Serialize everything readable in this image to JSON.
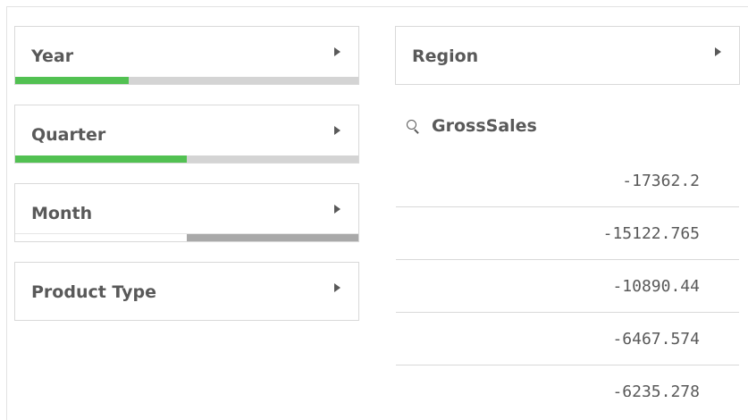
{
  "filters": {
    "year": {
      "label": "Year",
      "bar": [
        {
          "fraction": 0.33,
          "color": "#52c152"
        },
        {
          "fraction": 0.67,
          "color": "#d4d4d4"
        }
      ]
    },
    "quarter": {
      "label": "Quarter",
      "bar": [
        {
          "fraction": 0.5,
          "color": "#52c152"
        },
        {
          "fraction": 0.5,
          "color": "#d4d4d4"
        }
      ]
    },
    "month": {
      "label": "Month",
      "bar": [
        {
          "fraction": 0.5,
          "color": "#ffffff"
        },
        {
          "fraction": 0.5,
          "color": "#a9a9a9"
        }
      ]
    },
    "product_type": {
      "label": "Product Type",
      "bar": []
    },
    "region": {
      "label": "Region",
      "bar": []
    }
  },
  "gross_sales": {
    "title": "GrossSales",
    "icon": "search-icon",
    "values": [
      "-17362.2",
      "-15122.765",
      "-10890.44",
      "-6467.574",
      "-6235.278"
    ]
  }
}
